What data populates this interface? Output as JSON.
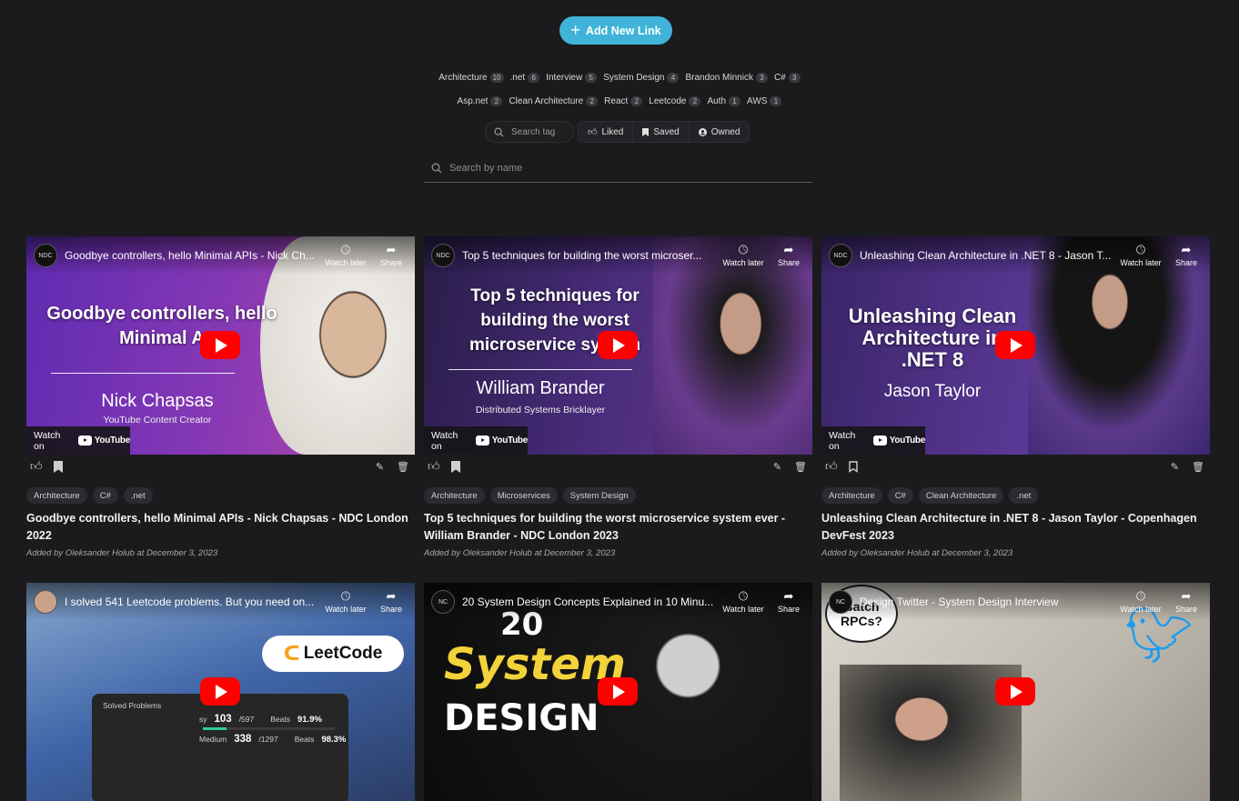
{
  "header": {
    "add_link_label": "Add New Link",
    "tag_rows": [
      [
        {
          "name": "Architecture",
          "count": "10"
        },
        {
          "name": ".net",
          "count": "6"
        },
        {
          "name": "Interview",
          "count": "5"
        },
        {
          "name": "System Design",
          "count": "4"
        },
        {
          "name": "Brandon Minnick",
          "count": "3"
        },
        {
          "name": "C#",
          "count": "3"
        }
      ],
      [
        {
          "name": "Asp.net",
          "count": "2"
        },
        {
          "name": "Clean Architecture",
          "count": "2"
        },
        {
          "name": "React",
          "count": "2"
        },
        {
          "name": "Leetcode",
          "count": "2"
        },
        {
          "name": "Auth",
          "count": "1"
        },
        {
          "name": "AWS",
          "count": "1"
        }
      ]
    ],
    "search_tag_placeholder": "Search tag",
    "filters": {
      "liked": "Liked",
      "saved": "Saved",
      "owned": "Owned"
    },
    "search_name_placeholder": "Search by name"
  },
  "yt": {
    "watch_later": "Watch later",
    "share": "Share",
    "watch_on": "Watch on",
    "youtube": "YouTube"
  },
  "cards": [
    {
      "yt_title": "Goodbye controllers, hello Minimal APIs - Nick Ch...",
      "channel": "NDC",
      "overlay_title": "Goodbye controllers, hello Minimal A",
      "overlay_name": "Nick Chapsas",
      "overlay_sub": "YouTube Content Creator",
      "tags": [
        "Architecture",
        "C#",
        ".net"
      ],
      "title": "Goodbye controllers, hello Minimal APIs - Nick Chapsas - NDC London 2022",
      "meta": "Added by Oleksander Holub at December 3, 2023"
    },
    {
      "yt_title": "Top 5 techniques for building the worst microser...",
      "channel": "NDC",
      "overlay_title": "Top 5 techniques for building the worst microservice system",
      "overlay_name": "William Brander",
      "overlay_sub": "Distributed Systems Bricklayer",
      "tags": [
        "Architecture",
        "Microservices",
        "System Design"
      ],
      "title": "Top 5 techniques for building the worst microservice system ever - William Brander - NDC London 2023",
      "meta": "Added by Oleksander Holub at December 3, 2023"
    },
    {
      "yt_title": "Unleashing Clean Architecture in .NET 8 - Jason T...",
      "channel": "NDC",
      "overlay_title": "Unleashing Clean Architecture in .NET 8",
      "overlay_name": "Jason Taylor",
      "overlay_sub": "",
      "tags": [
        "Architecture",
        "C#",
        "Clean Architecture",
        ".net"
      ],
      "title": "Unleashing Clean Architecture in .NET 8 - Jason Taylor - Copenhagen DevFest 2023",
      "meta": "Added by Oleksander Holub at December 3, 2023"
    },
    {
      "yt_title": "I solved 541 Leetcode problems. But you need on...",
      "channel": "",
      "badge": "LeetCode",
      "stats_title": "Solved Problems",
      "stats_easy_label": "sy",
      "stats_easy_num": "103",
      "stats_easy_total": "/597",
      "stats_easy_beats": "Beats",
      "stats_easy_pct": "91.9%",
      "stats_medium_label": "Medium",
      "stats_medium_num": "338",
      "stats_medium_total": "/1297",
      "stats_medium_beats": "Beats",
      "stats_medium_pct": "98.3%"
    },
    {
      "yt_title": "20 System Design Concepts Explained in 10 Minu...",
      "channel": "NC",
      "overlay_20": "20",
      "overlay_system": "System",
      "overlay_design": "DESIGN"
    },
    {
      "yt_title": "Design Twitter - System Design Interview",
      "channel": "NC",
      "bubble": "Batch RPCs?"
    }
  ]
}
